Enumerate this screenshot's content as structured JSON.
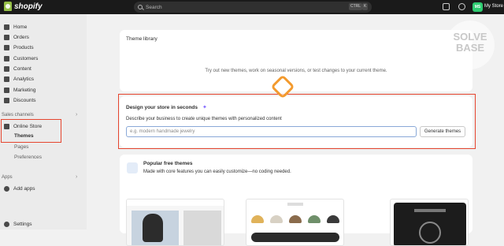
{
  "topbar": {
    "brand": "shopify",
    "search_placeholder": "Search",
    "kbd_ctrl": "CTRL",
    "kbd_k": "K",
    "avatar_initials": "MS",
    "store_name": "My Store"
  },
  "sidebar": {
    "items": [
      {
        "label": "Home",
        "icon": "home-icon"
      },
      {
        "label": "Orders",
        "icon": "orders-icon"
      },
      {
        "label": "Products",
        "icon": "tag-icon"
      },
      {
        "label": "Customers",
        "icon": "person-icon"
      },
      {
        "label": "Content",
        "icon": "content-icon"
      },
      {
        "label": "Analytics",
        "icon": "analytics-icon"
      },
      {
        "label": "Marketing",
        "icon": "target-icon"
      },
      {
        "label": "Discounts",
        "icon": "discount-icon"
      }
    ],
    "sales_channels_label": "Sales channels",
    "online_store": "Online Store",
    "themes": "Themes",
    "pages": "Pages",
    "preferences": "Preferences",
    "apps_label": "Apps",
    "add_apps": "Add apps",
    "settings": "Settings"
  },
  "main": {
    "theme_library_title": "Theme library",
    "theme_library_hint": "Try out new themes, work on seasonal versions, or test changes to your current theme.",
    "design_title": "Design your store in seconds",
    "design_desc": "Describe your business to create unique themes with personalized content",
    "design_placeholder": "e.g. modern handmade jewelry",
    "generate_button": "Generate themes",
    "popular_title": "Popular free themes",
    "popular_desc": "Made with core features you can easily customize—no coding needed."
  },
  "watermark": {
    "line1": "SOLVE",
    "line2": "BASE"
  },
  "colors": {
    "accent_red": "#e5452f",
    "brand_green": "#95bf47",
    "focus_orange": "#f39a2e"
  }
}
